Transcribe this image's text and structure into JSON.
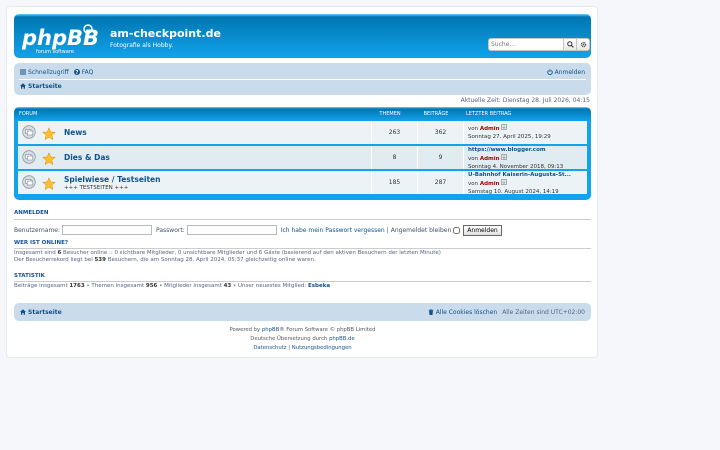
{
  "site": {
    "title": "am-checkpoint.de",
    "description": "Fotografie als Hobby.",
    "search_placeholder": "Suche..."
  },
  "nav": {
    "quicklinks": "Schnellzugriff",
    "faq": "FAQ",
    "login": "Anmelden",
    "home": "Startseite"
  },
  "current_time": "Aktuelle Zeit: Dienstag 28. Juli 2026, 04:15",
  "forum_table": {
    "headers": {
      "forum": "FORUM",
      "topics": "THEMEN",
      "posts": "BEITRÄGE",
      "last_post": "LETZTER BEITRAG"
    },
    "rows": [
      {
        "name": "News",
        "description": "",
        "topics": "263",
        "posts": "362",
        "last_title": "",
        "by": "von",
        "author": "Admin",
        "date": "Sonntag 27. April 2025, 19:29"
      },
      {
        "name": "Dies & Das",
        "description": "",
        "topics": "8",
        "posts": "9",
        "last_title": "https://www.blogger.com",
        "by": "von",
        "author": "Admin",
        "date": "Sonntag 4. November 2018, 09:13"
      },
      {
        "name": "Spielwiese / Testseiten",
        "description": "+++ TESTSEITEN +++",
        "topics": "185",
        "posts": "287",
        "last_title": "U-Bahnhof Kaiserin-Augusta-St...",
        "by": "von",
        "author": "Admin",
        "date": "Samstag 10. August 2024, 14:19"
      }
    ]
  },
  "login": {
    "title": "ANMELDEN",
    "username_label": "Benutzername:",
    "password_label": "Passwort:",
    "forgot": "Ich habe mein Passwort vergessen",
    "separator": "|",
    "remember": "Angemeldet bleiben",
    "button": "Anmelden"
  },
  "online": {
    "title": "WER IST ONLINE?",
    "line1_pre": "Insgesamt sind",
    "line1_count": "6",
    "line1_post": "Besucher online :: 0 sichtbare Mitglieder, 0 unsichtbare Mitglieder und 6 Gäste (basierend auf den aktiven Besuchern der letzten Minute)",
    "line2_pre": "Der Besucherrekord liegt bei",
    "line2_count": "539",
    "line2_post": "Besuchern, die am Sonntag 28. April 2024, 05:37 gleichzeitig online waren."
  },
  "stats": {
    "title": "STATISTIK",
    "posts_label": "Beiträge insgesamt",
    "posts": "1763",
    "topics_label": "• Themen insgesamt",
    "topics": "956",
    "members_label": "• Mitglieder insgesamt",
    "members": "43",
    "newest_label": "• Unser neuestes Mitglied:",
    "newest": "Esbeka"
  },
  "footer": {
    "home": "Startseite",
    "delete_cookies": "Alle Cookies löschen",
    "timezone": "Alle Zeiten sind UTC+02:00",
    "powered_pre": "Powered by",
    "powered_link": "phpBB",
    "powered_post": "® Forum Software © phpBB Limited",
    "translation_pre": "Deutsche Übersetzung durch",
    "translation_link": "phpBB.de",
    "privacy": "Datenschutz",
    "sep": "|",
    "terms": "Nutzungsbedingungen"
  },
  "colors": {
    "header_blue": "#12a3eb",
    "navbar": "#cadceb",
    "link": "#105289",
    "author_red": "#aa0000"
  },
  "icons": [
    "phpbb-logo",
    "search-icon",
    "advanced-search-icon",
    "menu-icon",
    "faq-icon",
    "power-icon",
    "home-icon",
    "forum-read-icon",
    "star-icon",
    "view-latest-icon",
    "trash-icon"
  ]
}
